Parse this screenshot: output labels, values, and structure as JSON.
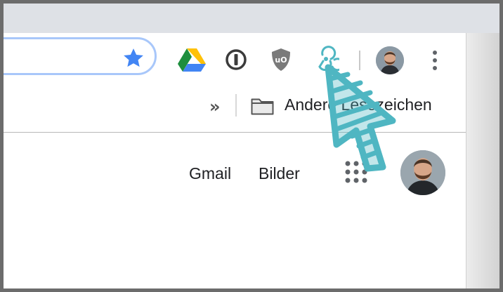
{
  "toolbar": {
    "icons": {
      "bookmark": "star-icon",
      "drive": "google-drive-icon",
      "password_manager": "1password-icon",
      "adblock": "ublock-origin-icon",
      "webhook": "webhook-extension-icon",
      "menu": "three-dot-menu-icon"
    },
    "ublock_text": "uO"
  },
  "bookmarks_bar": {
    "overflow_label": "»",
    "folder_label": "Andere Lesezeichen"
  },
  "google_bar": {
    "gmail_label": "Gmail",
    "images_label": "Bilder"
  },
  "colors": {
    "accent_blue": "#4285f4",
    "cursor_teal": "#4fb6c2",
    "tabstrip": "#dee1e6",
    "frame": "#6c6c6c"
  }
}
